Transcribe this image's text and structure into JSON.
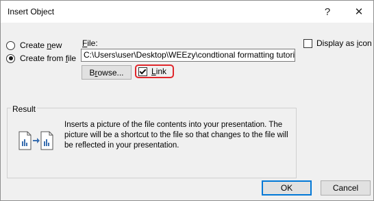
{
  "window": {
    "title": "Insert Object",
    "help": "?",
    "close": "✕"
  },
  "options": {
    "create_new": {
      "pre": "Create ",
      "key": "n",
      "post": "ew",
      "selected": false
    },
    "create_from_file": {
      "pre": "Create from ",
      "key": "f",
      "post": "ile",
      "selected": true
    }
  },
  "file": {
    "label_key": "F",
    "label_rest": "ile:",
    "value": "C:\\Users\\user\\Desktop\\WEEzy\\condtional formatting tutorial",
    "browse_pre": "B",
    "browse_key": "r",
    "browse_post": "owse..."
  },
  "link": {
    "key": "L",
    "rest": "ink",
    "checked": true
  },
  "display_as_icon": {
    "pre": "Display as ",
    "key": "i",
    "post": "con",
    "checked": false
  },
  "result": {
    "label": "Result",
    "text": "Inserts a picture of the file contents into your presentation. The picture will be a shortcut to the file so that changes to the file will be reflected in your presentation.",
    "icon": "link-file-icon"
  },
  "buttons": {
    "ok": "OK",
    "cancel": "Cancel"
  },
  "colors": {
    "highlight": "#e0262b",
    "default_button_border": "#0078d7"
  }
}
